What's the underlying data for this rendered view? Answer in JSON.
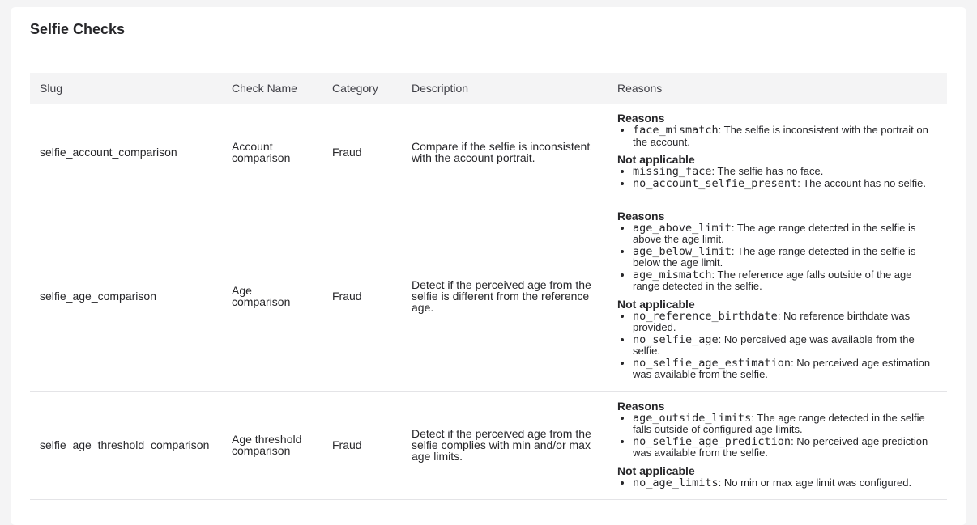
{
  "card": {
    "title": "Selfie Checks"
  },
  "table": {
    "headers": [
      "Slug",
      "Check Name",
      "Category",
      "Description",
      "Reasons"
    ],
    "rows": [
      {
        "slug": "selfie_account_comparison",
        "name": "Account comparison",
        "category": "Fraud",
        "description": "Compare if the selfie is inconsistent with the account portrait.",
        "reasons_title": "Reasons",
        "reasons": [
          {
            "code": "face_mismatch",
            "text": ": The selfie is inconsistent with the portrait on the account."
          }
        ],
        "na_title": "Not applicable",
        "not_applicable": [
          {
            "code": "missing_face",
            "text": ": The selfie has no face."
          },
          {
            "code": "no_account_selfie_present",
            "text": ": The account has no selfie."
          }
        ]
      },
      {
        "slug": "selfie_age_comparison",
        "name": "Age comparison",
        "category": "Fraud",
        "description": "Detect if the perceived age from the selfie is different from the reference age.",
        "reasons_title": "Reasons",
        "reasons": [
          {
            "code": "age_above_limit",
            "text": ": The age range detected in the selfie is above the age limit."
          },
          {
            "code": "age_below_limit",
            "text": ": The age range detected in the selfie is below the age limit."
          },
          {
            "code": "age_mismatch",
            "text": ": The reference age falls outside of the age range detected in the selfie."
          }
        ],
        "na_title": "Not applicable",
        "not_applicable": [
          {
            "code": "no_reference_birthdate",
            "text": ": No reference birthdate was provided."
          },
          {
            "code": "no_selfie_age",
            "text": ": No perceived age was available from the selfie."
          },
          {
            "code": "no_selfie_age_estimation",
            "text": ": No perceived age estimation was available from the selfie."
          }
        ]
      },
      {
        "slug": "selfie_age_threshold_comparison",
        "name": "Age threshold comparison",
        "category": "Fraud",
        "description": "Detect if the perceived age from the selfie complies with min and/or max age limits.",
        "reasons_title": "Reasons",
        "reasons": [
          {
            "code": "age_outside_limits",
            "text": ": The age range detected in the selfie falls outside of configured age limits."
          },
          {
            "code": "no_selfie_age_prediction",
            "text": ": No perceived age prediction was available from the selfie."
          }
        ],
        "na_title": "Not applicable",
        "not_applicable": [
          {
            "code": "no_age_limits",
            "text": ": No min or max age limit was configured."
          }
        ]
      }
    ]
  }
}
